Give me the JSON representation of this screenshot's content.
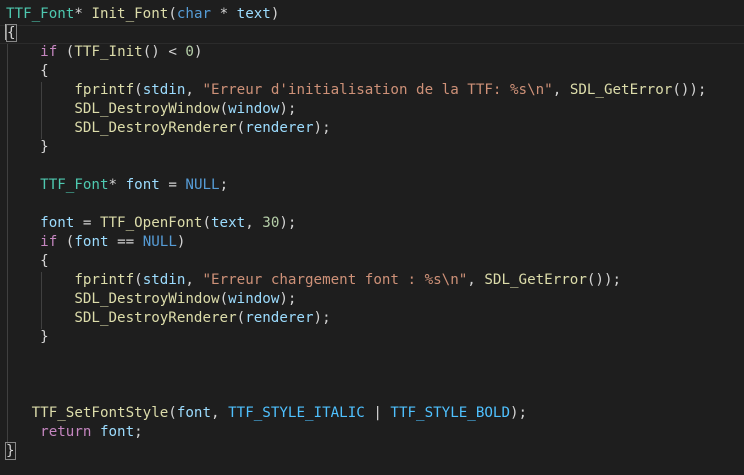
{
  "editor": {
    "language": "c",
    "colors": {
      "background": "#1e1e1e",
      "type": "#4ec9b0",
      "function": "#dcdcaa",
      "keyword": "#569cd6",
      "control": "#c586c0",
      "variable": "#9cdcfe",
      "string": "#ce9178",
      "number": "#b5cea8",
      "constant": "#4fc1ff"
    },
    "lines": [
      [
        [
          "type",
          "TTF_Font"
        ],
        [
          "punc",
          "* "
        ],
        [
          "fn",
          "Init_Font"
        ],
        [
          "punc",
          "("
        ],
        [
          "kw",
          "char"
        ],
        [
          "punc",
          " * "
        ],
        [
          "var",
          "text"
        ],
        [
          "punc",
          ")"
        ]
      ],
      [
        [
          "brace",
          "{"
        ]
      ],
      [
        [
          "punc",
          "    "
        ],
        [
          "ctrl",
          "if"
        ],
        [
          "punc",
          " ("
        ],
        [
          "fn",
          "TTF_Init"
        ],
        [
          "punc",
          "() < "
        ],
        [
          "num",
          "0"
        ],
        [
          "punc",
          ")"
        ]
      ],
      [
        [
          "punc",
          "    {"
        ]
      ],
      [
        [
          "punc",
          "        "
        ],
        [
          "fn",
          "fprintf"
        ],
        [
          "punc",
          "("
        ],
        [
          "var",
          "stdin"
        ],
        [
          "punc",
          ", "
        ],
        [
          "str",
          "\"Erreur d'initialisation de la TTF: %s\\n\""
        ],
        [
          "punc",
          ", "
        ],
        [
          "fn",
          "SDL_GetError"
        ],
        [
          "punc",
          "());"
        ]
      ],
      [
        [
          "punc",
          "        "
        ],
        [
          "fn",
          "SDL_DestroyWindow"
        ],
        [
          "punc",
          "("
        ],
        [
          "var",
          "window"
        ],
        [
          "punc",
          ");"
        ]
      ],
      [
        [
          "punc",
          "        "
        ],
        [
          "fn",
          "SDL_DestroyRenderer"
        ],
        [
          "punc",
          "("
        ],
        [
          "var",
          "renderer"
        ],
        [
          "punc",
          ");"
        ]
      ],
      [
        [
          "punc",
          "    }"
        ]
      ],
      [],
      [
        [
          "punc",
          "    "
        ],
        [
          "type",
          "TTF_Font"
        ],
        [
          "punc",
          "* "
        ],
        [
          "var",
          "font"
        ],
        [
          "punc",
          " = "
        ],
        [
          "kw",
          "NULL"
        ],
        [
          "punc",
          ";"
        ]
      ],
      [],
      [
        [
          "punc",
          "    "
        ],
        [
          "var",
          "font"
        ],
        [
          "punc",
          " = "
        ],
        [
          "fn",
          "TTF_OpenFont"
        ],
        [
          "punc",
          "("
        ],
        [
          "var",
          "text"
        ],
        [
          "punc",
          ", "
        ],
        [
          "num",
          "30"
        ],
        [
          "punc",
          ");"
        ]
      ],
      [
        [
          "punc",
          "    "
        ],
        [
          "ctrl",
          "if"
        ],
        [
          "punc",
          " ("
        ],
        [
          "var",
          "font"
        ],
        [
          "punc",
          " == "
        ],
        [
          "kw",
          "NULL"
        ],
        [
          "punc",
          ")"
        ]
      ],
      [
        [
          "punc",
          "    {"
        ]
      ],
      [
        [
          "punc",
          "        "
        ],
        [
          "fn",
          "fprintf"
        ],
        [
          "punc",
          "("
        ],
        [
          "var",
          "stdin"
        ],
        [
          "punc",
          ", "
        ],
        [
          "str",
          "\"Erreur chargement font : %s\\n\""
        ],
        [
          "punc",
          ", "
        ],
        [
          "fn",
          "SDL_GetError"
        ],
        [
          "punc",
          "());"
        ]
      ],
      [
        [
          "punc",
          "        "
        ],
        [
          "fn",
          "SDL_DestroyWindow"
        ],
        [
          "punc",
          "("
        ],
        [
          "var",
          "window"
        ],
        [
          "punc",
          ");"
        ]
      ],
      [
        [
          "punc",
          "        "
        ],
        [
          "fn",
          "SDL_DestroyRenderer"
        ],
        [
          "punc",
          "("
        ],
        [
          "var",
          "renderer"
        ],
        [
          "punc",
          ");"
        ]
      ],
      [
        [
          "punc",
          "    }"
        ]
      ],
      [],
      [],
      [],
      [
        [
          "punc",
          "   "
        ],
        [
          "fn",
          "TTF_SetFontStyle"
        ],
        [
          "punc",
          "("
        ],
        [
          "var",
          "font"
        ],
        [
          "punc",
          ", "
        ],
        [
          "const",
          "TTF_STYLE_ITALIC"
        ],
        [
          "punc",
          " | "
        ],
        [
          "const",
          "TTF_STYLE_BOLD"
        ],
        [
          "punc",
          ");"
        ]
      ],
      [
        [
          "punc",
          "    "
        ],
        [
          "ctrl",
          "return"
        ],
        [
          "punc",
          " "
        ],
        [
          "var",
          "font"
        ],
        [
          "punc",
          ";"
        ]
      ],
      [
        [
          "brace",
          "}"
        ]
      ]
    ]
  }
}
